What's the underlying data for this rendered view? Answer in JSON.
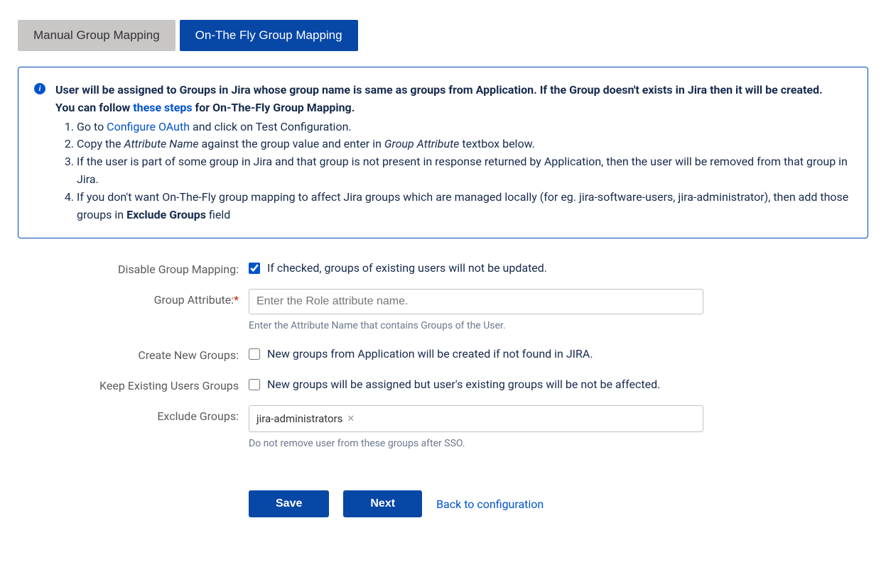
{
  "tabs": {
    "manual": "Manual Group Mapping",
    "onthefly": "On-The Fly Group Mapping"
  },
  "info": {
    "line1_bold": "User will be assigned to Groups in Jira whose group name is same as groups from Application. If the Group doesn't exists in Jira then it will be created.",
    "line2_prefix": "You can follow ",
    "line2_link": "these steps",
    "line2_suffix": " for On-The-Fly Group Mapping.",
    "step1_prefix": "Go to ",
    "step1_link": "Configure OAuth",
    "step1_suffix": " and click on Test Configuration.",
    "step2_a": "Copy the ",
    "step2_em1": "Attribute Name",
    "step2_b": " against the group value and enter in ",
    "step2_em2": "Group Attribute",
    "step2_c": " textbox below.",
    "step3": "If the user is part of some group in Jira and that group is not present in response returned by Application, then the user will be removed from that group in Jira.",
    "step4_a": "If you don't want On-The-Fly group mapping to affect Jira groups which are managed locally (for eg. jira-software-users, jira-administrator), then add those groups in ",
    "step4_strong": "Exclude Groups",
    "step4_b": " field"
  },
  "form": {
    "disable_mapping": {
      "label": "Disable Group Mapping:",
      "checked": true,
      "text": "If checked, groups of existing users will not be updated."
    },
    "group_attribute": {
      "label": "Group Attribute:",
      "placeholder": "Enter the Role attribute name.",
      "value": "",
      "help": "Enter the Attribute Name that contains Groups of the User."
    },
    "create_new_groups": {
      "label": "Create New Groups:",
      "checked": false,
      "text": "New groups from Application will be created if not found in JIRA."
    },
    "keep_existing": {
      "label": "Keep Existing Users Groups",
      "checked": false,
      "text": "New groups will be assigned but user's existing groups will be not be affected."
    },
    "exclude_groups": {
      "label": "Exclude Groups:",
      "tag": "jira-administrators",
      "help": "Do not remove user from these groups after SSO."
    }
  },
  "buttons": {
    "save": "Save",
    "next": "Next",
    "back": "Back to configuration"
  }
}
